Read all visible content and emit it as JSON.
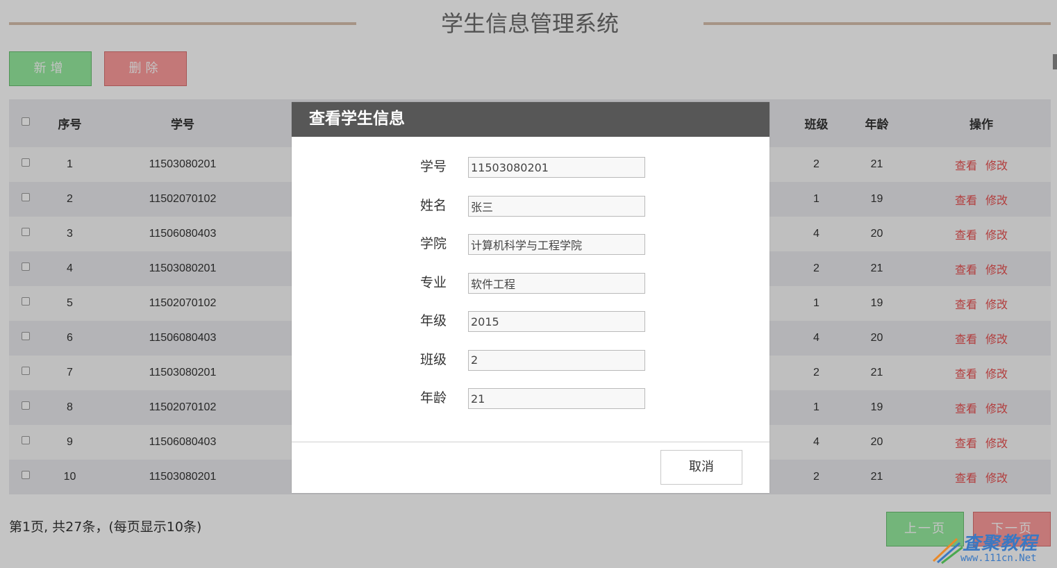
{
  "header": {
    "title": "学生信息管理系统"
  },
  "toolbar": {
    "add_label": "新增",
    "delete_label": "删除"
  },
  "table": {
    "headers": {
      "index": "序号",
      "student_id": "学号",
      "class": "班级",
      "age": "年龄",
      "ops": "操作"
    },
    "rows": [
      {
        "index": "1",
        "student_id": "11503080201",
        "class": "2",
        "age": "21",
        "view": "查看",
        "edit": "修改"
      },
      {
        "index": "2",
        "student_id": "11502070102",
        "class": "1",
        "age": "19",
        "view": "查看",
        "edit": "修改"
      },
      {
        "index": "3",
        "student_id": "11506080403",
        "class": "4",
        "age": "20",
        "view": "查看",
        "edit": "修改"
      },
      {
        "index": "4",
        "student_id": "11503080201",
        "class": "2",
        "age": "21",
        "view": "查看",
        "edit": "修改"
      },
      {
        "index": "5",
        "student_id": "11502070102",
        "class": "1",
        "age": "19",
        "view": "查看",
        "edit": "修改"
      },
      {
        "index": "6",
        "student_id": "11506080403",
        "class": "4",
        "age": "20",
        "view": "查看",
        "edit": "修改"
      },
      {
        "index": "7",
        "student_id": "11503080201",
        "class": "2",
        "age": "21",
        "view": "查看",
        "edit": "修改"
      },
      {
        "index": "8",
        "student_id": "11502070102",
        "class": "1",
        "age": "19",
        "view": "查看",
        "edit": "修改"
      },
      {
        "index": "9",
        "student_id": "11506080403",
        "class": "4",
        "age": "20",
        "view": "查看",
        "edit": "修改"
      },
      {
        "index": "10",
        "student_id": "11503080201",
        "class": "2",
        "age": "21",
        "view": "查看",
        "edit": "修改"
      }
    ]
  },
  "footer": {
    "info": "第1页, 共27条，(每页显示10条)",
    "prev_label": "上一页",
    "next_label": "下一页"
  },
  "modal": {
    "title": "查看学生信息",
    "fields": [
      {
        "label": "学号",
        "value": "11503080201"
      },
      {
        "label": "姓名",
        "value": "张三"
      },
      {
        "label": "学院",
        "value": "计算机科学与工程学院"
      },
      {
        "label": "专业",
        "value": "软件工程"
      },
      {
        "label": "年级",
        "value": "2015"
      },
      {
        "label": "班级",
        "value": "2"
      },
      {
        "label": "年龄",
        "value": "21"
      }
    ],
    "cancel_label": "取消"
  },
  "watermark": {
    "brand": "査聚教程",
    "url": "www.111cn.Net"
  },
  "colors": {
    "add": "#96ec9f",
    "delete": "#fe9c9c",
    "modal_header": "#575757",
    "link": "#e85050"
  }
}
